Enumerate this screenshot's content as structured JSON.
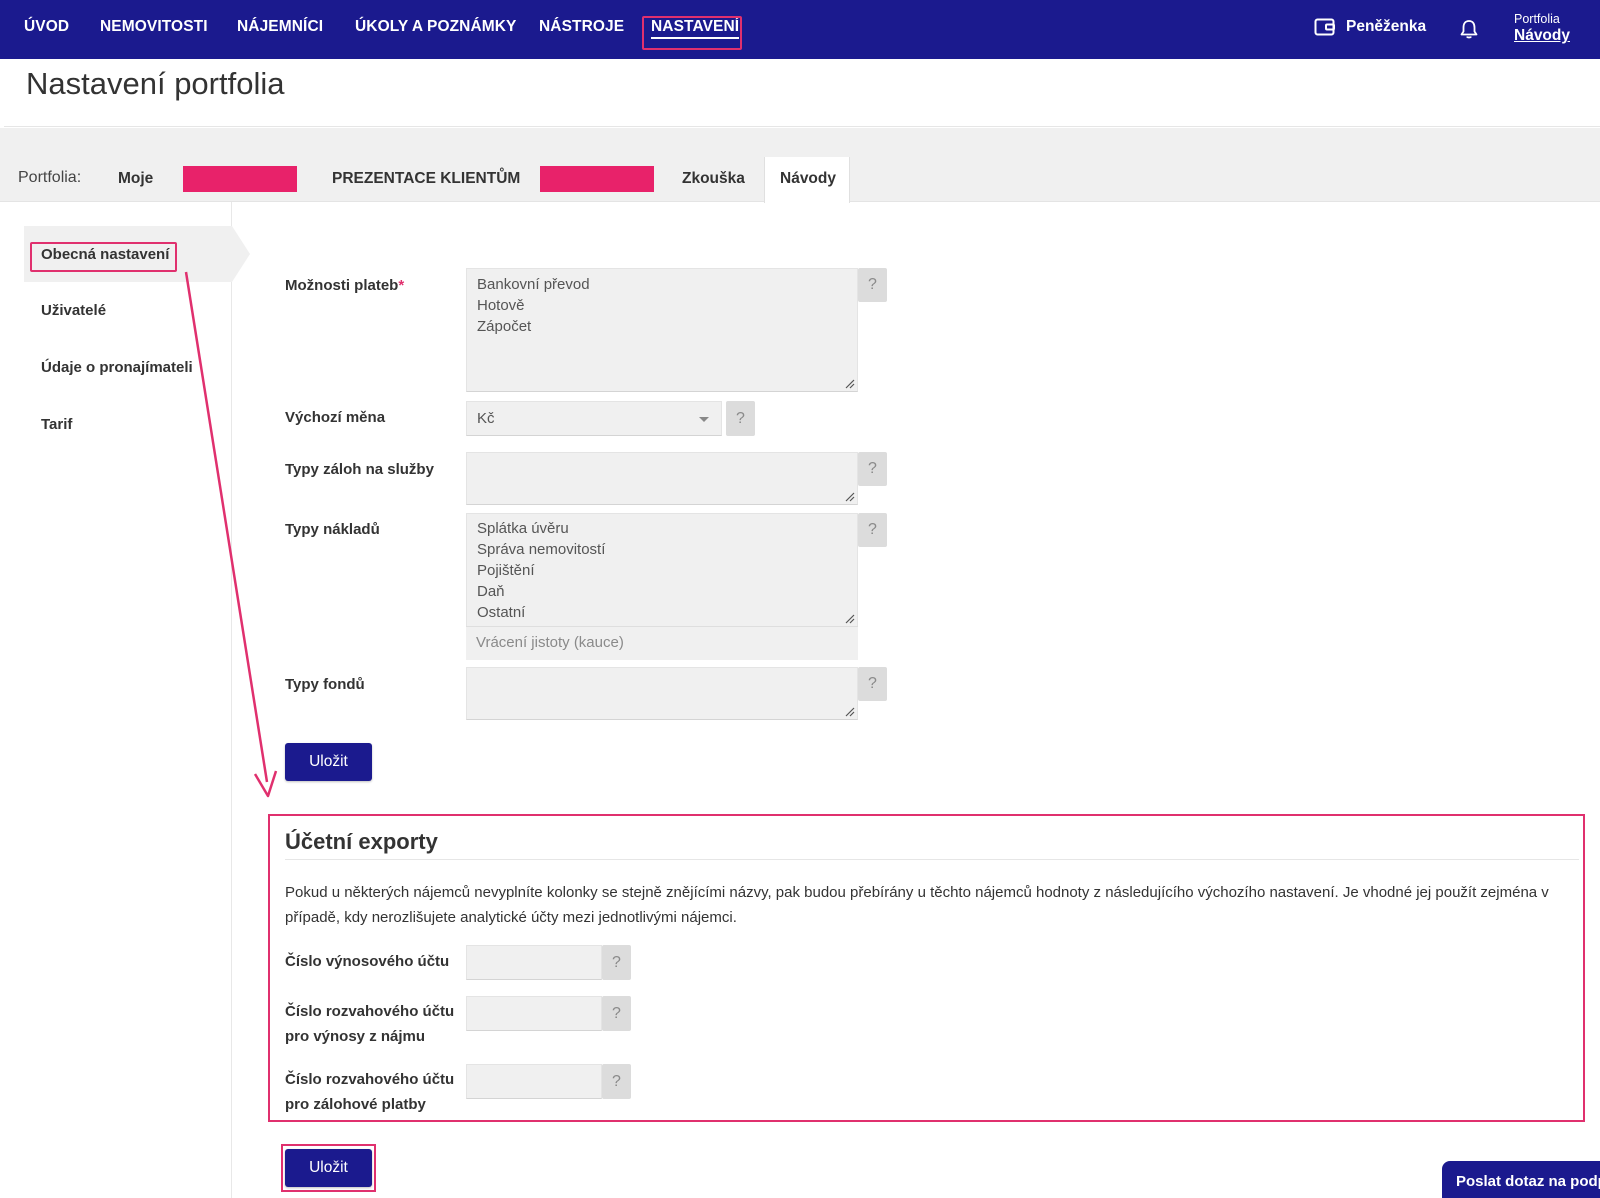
{
  "nav": {
    "items": [
      "ÚVOD",
      "NEMOVITOSTI",
      "NÁJEMNÍCI",
      "ÚKOLY A POZNÁMKY",
      "NÁSTROJE",
      "NASTAVENÍ"
    ],
    "active": "NASTAVENÍ",
    "wallet_label": "Peněženka",
    "wallet_icon": "wallet-icon",
    "notifications_icon": "bell-icon",
    "portfolio_small": "Portfolia",
    "portfolio_current": "Návody"
  },
  "page": {
    "title": "Nastavení portfolia"
  },
  "portfolio_tabs": {
    "label": "Portfolia:",
    "tabs": [
      "Moje",
      "",
      "PREZENTACE KLIENTŮM",
      "",
      "Zkouška",
      "Návody"
    ],
    "active": "Návody"
  },
  "sidebar": {
    "items": [
      "Obecná nastavení",
      "Uživatelé",
      "Údaje o pronajímateli",
      "Tarif"
    ],
    "active": "Obecná nastavení"
  },
  "form": {
    "payment_options": {
      "label": "Možnosti plateb",
      "required_mark": "*",
      "value": "Bankovní převod\nHotově\nZápočet",
      "help": "?"
    },
    "default_currency": {
      "label": "Výchozí měna",
      "value": "Kč",
      "help": "?"
    },
    "deposit_types": {
      "label": "Typy záloh na služby",
      "value": "",
      "help": "?"
    },
    "cost_types": {
      "label": "Typy nákladů",
      "value": "Splátka úvěru\nSpráva nemovitostí\nPojištění\nDaň\nOstatní",
      "note": "Vrácení jistoty (kauce)",
      "help": "?"
    },
    "fund_types": {
      "label": "Typy fondů",
      "value": "",
      "help": "?"
    },
    "save_label": "Uložit"
  },
  "exports": {
    "title": "Účetní exporty",
    "description": "Pokud u některých nájemců nevyplníte kolonky se stejně znějícími názvy, pak budou přebírány u těchto nájemců hodnoty z následujícího výchozího nastavení. Je vhodné jej použít zejména v případě, kdy nerozlišujete analytické účty mezi jednotlivými nájemci.",
    "revenue_account": {
      "label": "Číslo výnosového účtu",
      "value": "",
      "help": "?"
    },
    "balance_rent": {
      "label_line1": "Číslo rozvahového účtu",
      "label_line2": "pro výnosy z nájmu",
      "value": "",
      "help": "?"
    },
    "balance_deposit": {
      "label_line1": "Číslo rozvahového účtu",
      "label_line2": "pro zálohové platby",
      "value": "",
      "help": "?"
    },
    "save_label": "Uložit"
  },
  "support": {
    "label": "Poslat dotaz na podp"
  },
  "colors": {
    "brand": "#1b1a8e",
    "highlight": "#e0306e",
    "redacted": "#e8226a"
  }
}
